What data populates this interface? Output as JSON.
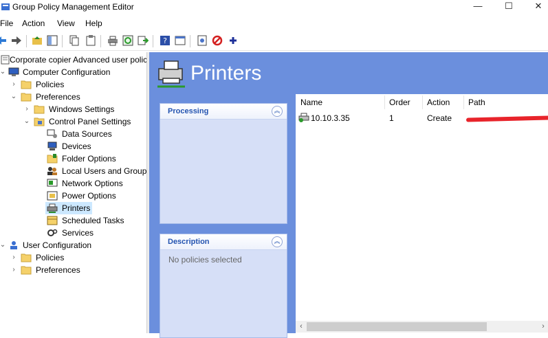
{
  "window": {
    "title": "Group Policy Management Editor",
    "minimize": "—",
    "maximize": "☐",
    "close": "✕"
  },
  "menu": [
    "File",
    "Action",
    "View",
    "Help"
  ],
  "tree": {
    "root": "Corporate copier Advanced user polic",
    "computer_config": "Computer Configuration",
    "policies": "Policies",
    "preferences": "Preferences",
    "windows_settings": "Windows Settings",
    "control_panel_settings": "Control Panel Settings",
    "items": [
      "Data Sources",
      "Devices",
      "Folder Options",
      "Local Users and Groups",
      "Network Options",
      "Power Options",
      "Printers",
      "Scheduled Tasks",
      "Services"
    ],
    "user_config": "User Configuration",
    "user_policies": "Policies",
    "user_preferences": "Preferences"
  },
  "header": {
    "title": "Printers"
  },
  "processing": {
    "title": "Processing",
    "body": ""
  },
  "description": {
    "title": "Description",
    "body": "No policies selected"
  },
  "list": {
    "columns": [
      "Name",
      "Order",
      "Action",
      "Path"
    ],
    "rows": [
      {
        "name": "10.10.3.35",
        "order": "1",
        "action": "Create",
        "path": ""
      }
    ]
  },
  "colors": {
    "pane_bg": "#6b8fdd",
    "box_bg": "#d6dff7",
    "box_title": "#2353b0",
    "selection": "#cce8ff"
  }
}
